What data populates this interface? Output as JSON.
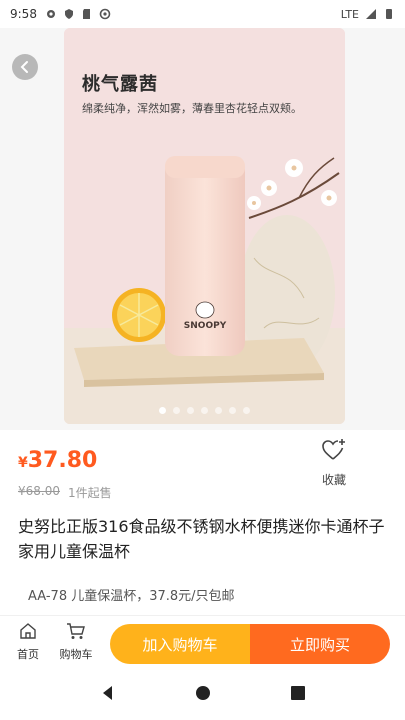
{
  "status_bar": {
    "time": "9:58",
    "network": "LTE"
  },
  "hero": {
    "title": "桃气露茜",
    "subtitle": "绵柔纯净，浑然如雾，薄春里杏花轻点双颊。",
    "bottle_brand": "SNOOPY",
    "dots_total": 7,
    "dot_active_index": 0
  },
  "product": {
    "currency": "¥",
    "price": "37.80",
    "original_price": "¥68.00",
    "min_order": "1件起售",
    "title": "史努比正版316食品级不锈钢水杯便携迷你卡通杯子家用儿童保温杯",
    "spec": "AA-78 儿童保温杯，37.8元/只包邮"
  },
  "favorite": {
    "label": "收藏"
  },
  "bottom_bar": {
    "home_label": "首页",
    "cart_label": "购物车",
    "add_to_cart": "加入购物车",
    "buy_now": "立即购买"
  },
  "colors": {
    "accent": "#ff5a1f",
    "cart_btn": "#ffb21b",
    "buy_btn": "#ff6a1f"
  }
}
